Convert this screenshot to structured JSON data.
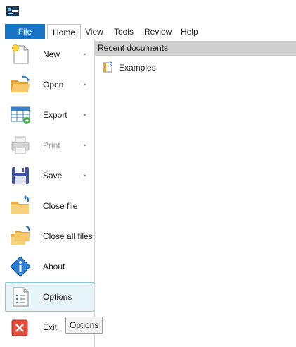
{
  "ribbon": {
    "tabs": [
      "File",
      "Home",
      "View",
      "Tools",
      "Review",
      "Help"
    ],
    "active_tab": "File"
  },
  "menu": {
    "items": [
      {
        "label": "New",
        "icon": "new-document-icon",
        "submenu": true,
        "enabled": true
      },
      {
        "label": "Open",
        "icon": "open-folder-icon",
        "submenu": true,
        "enabled": true
      },
      {
        "label": "Export",
        "icon": "export-table-icon",
        "submenu": true,
        "enabled": true
      },
      {
        "label": "Print",
        "icon": "printer-icon",
        "submenu": true,
        "enabled": false
      },
      {
        "label": "Save",
        "icon": "floppy-disk-icon",
        "submenu": true,
        "enabled": true
      },
      {
        "label": "Close file",
        "icon": "close-file-icon",
        "submenu": false,
        "enabled": true
      },
      {
        "label": "Close all files",
        "icon": "close-all-files-icon",
        "submenu": false,
        "enabled": true
      },
      {
        "label": "About",
        "icon": "info-icon",
        "submenu": false,
        "enabled": true
      },
      {
        "label": "Options",
        "icon": "options-icon",
        "submenu": false,
        "enabled": true,
        "selected": true
      },
      {
        "label": "Exit",
        "icon": "exit-icon",
        "submenu": false,
        "enabled": true
      }
    ],
    "submenu_glyph": "▸"
  },
  "recent": {
    "header": "Recent documents",
    "items": [
      {
        "label": "Examples",
        "icon": "document-icon"
      }
    ]
  },
  "tooltip": {
    "text": "Options"
  },
  "colors": {
    "file_tab": "#1874c4",
    "selected_item_bg": "#e6f3f7",
    "selected_item_border": "#8ec7dc",
    "header_bg": "#cfcfcf"
  }
}
